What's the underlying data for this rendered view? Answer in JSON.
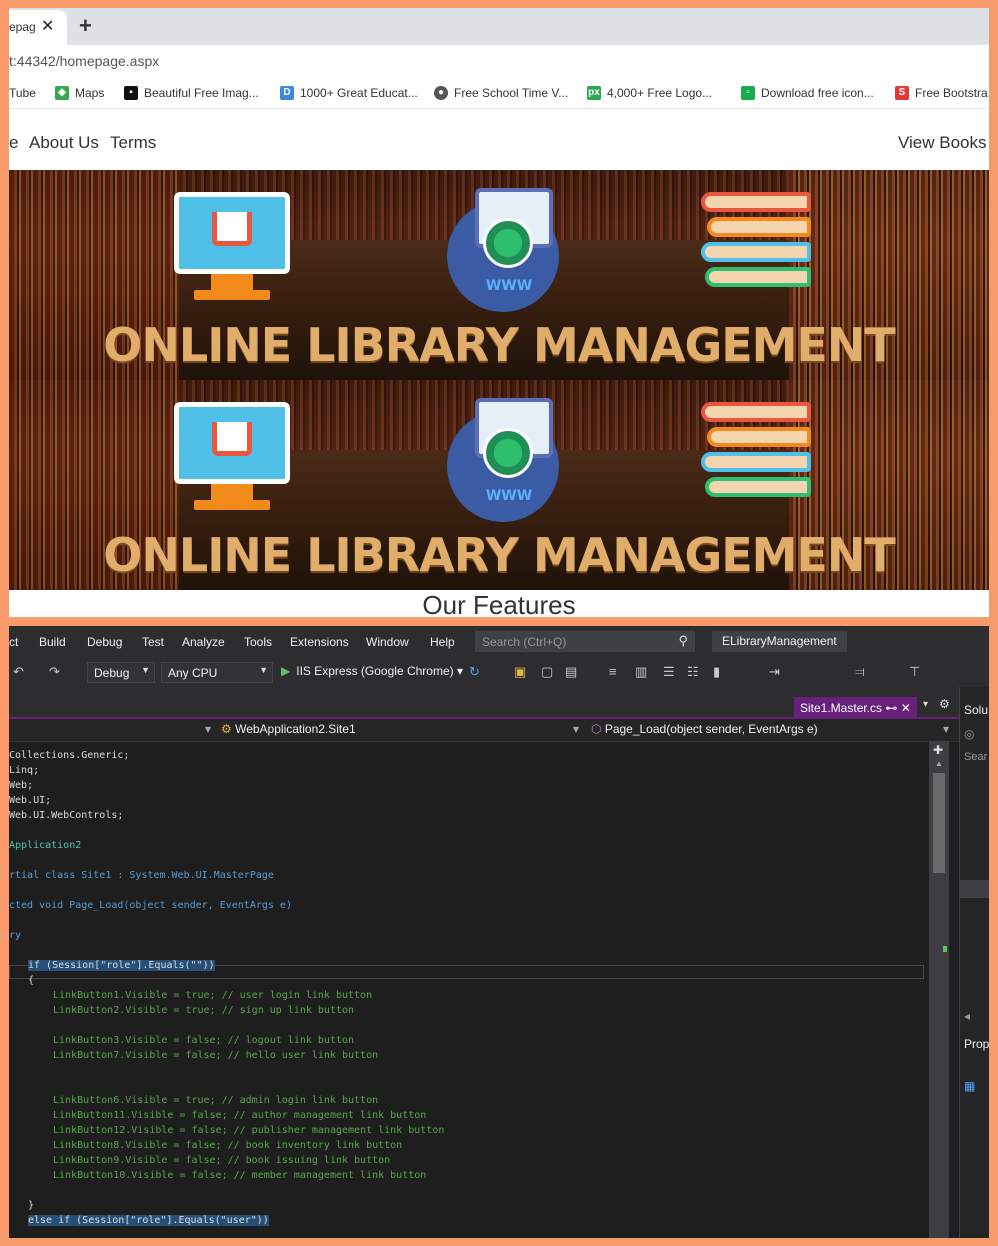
{
  "browser": {
    "tab_title": "epag",
    "tab_close": "✕",
    "new_tab": "+",
    "url": "t:44342/homepage.aspx",
    "bookmarks": [
      {
        "label": "Tube",
        "icon": "youtube-icon",
        "color": "#ff0000"
      },
      {
        "label": "Maps",
        "icon": "maps-icon",
        "color": "#34a853"
      },
      {
        "label": "Beautiful Free Imag...",
        "icon": "camera-icon",
        "color": "#111111"
      },
      {
        "label": "1000+ Great Educat...",
        "icon": "bookmark-icon",
        "color": "#3b8ad8"
      },
      {
        "label": "Free School Time V...",
        "icon": "globe-icon",
        "color": "#555555"
      },
      {
        "label": "4,000+ Free Logo...",
        "icon": "px-icon",
        "color": "#2ea44f"
      },
      {
        "label": "Download free icon...",
        "icon": "icon-site-icon",
        "color": "#1bab4c"
      },
      {
        "label": "Free Bootstra",
        "icon": "s-icon",
        "color": "#e53935"
      }
    ],
    "site_nav": {
      "partial": "e",
      "about": "About Us",
      "terms": "Terms",
      "view_books": "View Books"
    },
    "hero_text_1": "ONLINE LIBRARY MANAGEMENT",
    "hero_text_2": "ONLINE LIBRARY MANAGEMENT",
    "www": "WWW",
    "features_heading": "Our Features"
  },
  "vs": {
    "menu": [
      "ct",
      "Build",
      "Debug",
      "Test",
      "Analyze",
      "Tools",
      "Extensions",
      "Window",
      "Help"
    ],
    "search_placeholder": "Search (Ctrl+Q)",
    "solution_name": "ELibraryManagement",
    "config": "Debug",
    "platform": "Any CPU",
    "run_target": "IIS Express (Google Chrome)",
    "doc_tab": "Site1.Master.cs",
    "nav_class": "WebApplication2.Site1",
    "nav_member": "Page_Load(object sender, EventArgs e)",
    "side_labels": [
      "Solu",
      "Sear",
      "Prop"
    ],
    "code_lines": [
      "Collections.Generic;",
      "Linq;",
      "Web;",
      "Web.UI;",
      "Web.UI.WebControls;",
      "Application2",
      "rtial class Site1 : System.Web.UI.MasterPage",
      "cted void Page_Load(object sender, EventArgs e)",
      "ry",
      "if (Session[\"role\"].Equals(\"\"))",
      "{",
      "LinkButton1.Visible = true; // user login link button",
      "LinkButton2.Visible = true; // sign up link button",
      "LinkButton3.Visible = false; // logout link button",
      "LinkButton7.Visible = false; // hello user link button",
      "LinkButton6.Visible = true; // admin login link button",
      "LinkButton11.Visible = false; // author management link button",
      "LinkButton12.Visible = false; // publisher management link button",
      "LinkButton8.Visible = false; // book inventory link button",
      "LinkButton9.Visible = false; // book issuing link button",
      "LinkButton10.Visible = false; // member management link button",
      "}",
      "else if (Session[\"role\"].Equals(\"user\"))"
    ]
  }
}
